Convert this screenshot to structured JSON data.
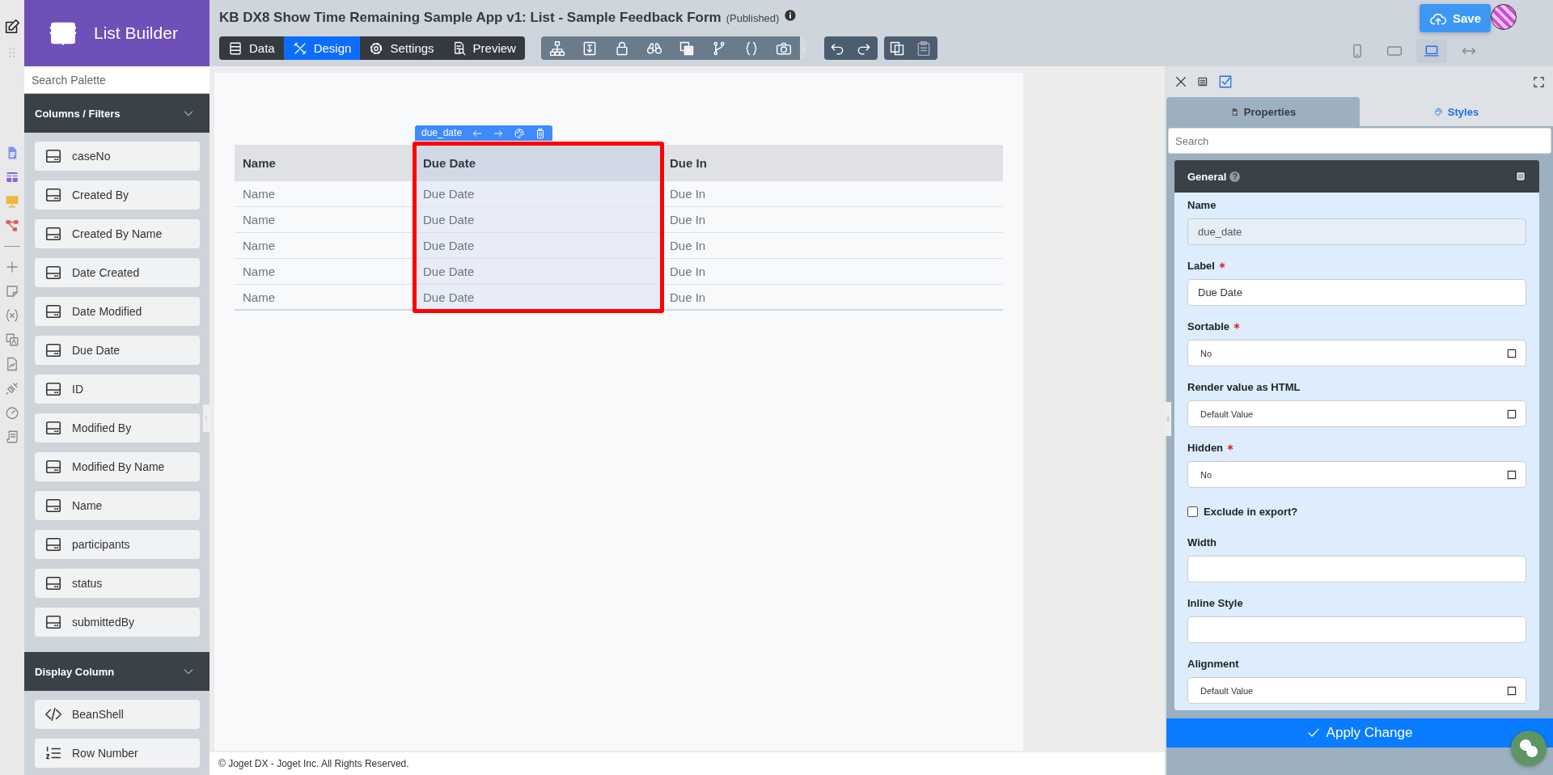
{
  "app_title": "List Builder",
  "page_title": "KB DX8 Show Time Remaining Sample App v1: List - Sample Feedback Form",
  "status": "(Published)",
  "mode_tabs": [
    {
      "label": "Data",
      "selected": false
    },
    {
      "label": "Design",
      "selected": true
    },
    {
      "label": "Settings",
      "selected": false
    },
    {
      "label": "Preview",
      "selected": false
    }
  ],
  "save_button": "Save",
  "device_views": [
    {
      "selected": false
    },
    {
      "selected": false
    },
    {
      "selected": true
    },
    {
      "selected": false
    }
  ],
  "palette": {
    "search_placeholder": "Search Palette",
    "sections": [
      {
        "title": "Columns / Filters",
        "expanded": true,
        "items": [
          {
            "label": "caseNo",
            "kind": "column"
          },
          {
            "label": "Created By",
            "kind": "column"
          },
          {
            "label": "Created By Name",
            "kind": "column"
          },
          {
            "label": "Date Created",
            "kind": "column"
          },
          {
            "label": "Date Modified",
            "kind": "column"
          },
          {
            "label": "Due Date",
            "kind": "column"
          },
          {
            "label": "ID",
            "kind": "column"
          },
          {
            "label": "Modified By",
            "kind": "column"
          },
          {
            "label": "Modified By Name",
            "kind": "column"
          },
          {
            "label": "Name",
            "kind": "column"
          },
          {
            "label": "participants",
            "kind": "column"
          },
          {
            "label": "status",
            "kind": "column"
          },
          {
            "label": "submittedBy",
            "kind": "column"
          }
        ]
      },
      {
        "title": "Display Column",
        "expanded": true,
        "items": [
          {
            "label": "BeanShell",
            "kind": "code"
          },
          {
            "label": "Row Number",
            "kind": "numbered"
          }
        ]
      }
    ]
  },
  "table": {
    "tag": "due_date",
    "columns": [
      {
        "label": "Name",
        "selected": false
      },
      {
        "label": "Due Date",
        "selected": true
      },
      {
        "label": "Due In",
        "selected": false
      }
    ],
    "rows": [
      [
        "Name",
        "Due Date",
        "Due In"
      ],
      [
        "Name",
        "Due Date",
        "Due In"
      ],
      [
        "Name",
        "Due Date",
        "Due In"
      ],
      [
        "Name",
        "Due Date",
        "Due In"
      ],
      [
        "Name",
        "Due Date",
        "Due In"
      ]
    ]
  },
  "footer": "© Joget DX - Joget Inc. All Rights Reserved.",
  "properties": {
    "tabs": [
      {
        "label": "Properties",
        "selected": true
      },
      {
        "label": "Styles",
        "selected": false
      }
    ],
    "search_placeholder": "Search",
    "section": "General",
    "help_mark": "?",
    "fields": [
      {
        "label": "Name",
        "kind": "text",
        "value": "due_date",
        "required": false,
        "disabled": true
      },
      {
        "label": "Label",
        "kind": "text",
        "value": "Due Date",
        "required": true,
        "disabled": false
      },
      {
        "label": "Sortable",
        "kind": "select",
        "value": "No",
        "required": true,
        "disabled": false
      },
      {
        "label": "Render value as HTML",
        "kind": "select",
        "value": "Default Value",
        "required": false,
        "disabled": false
      },
      {
        "label": "Hidden",
        "kind": "select",
        "value": "No",
        "required": true,
        "disabled": false
      },
      {
        "label": "Exclude in export?",
        "kind": "checkbox",
        "checked": false,
        "required": false,
        "disabled": false
      },
      {
        "label": "Width",
        "kind": "text",
        "required": false,
        "disabled": false
      },
      {
        "label": "Inline Style",
        "kind": "text",
        "required": false,
        "disabled": false
      },
      {
        "label": "Alignment",
        "kind": "select",
        "value": "Default Value",
        "required": false,
        "disabled": false
      }
    ],
    "apply_button": "Apply Change"
  }
}
